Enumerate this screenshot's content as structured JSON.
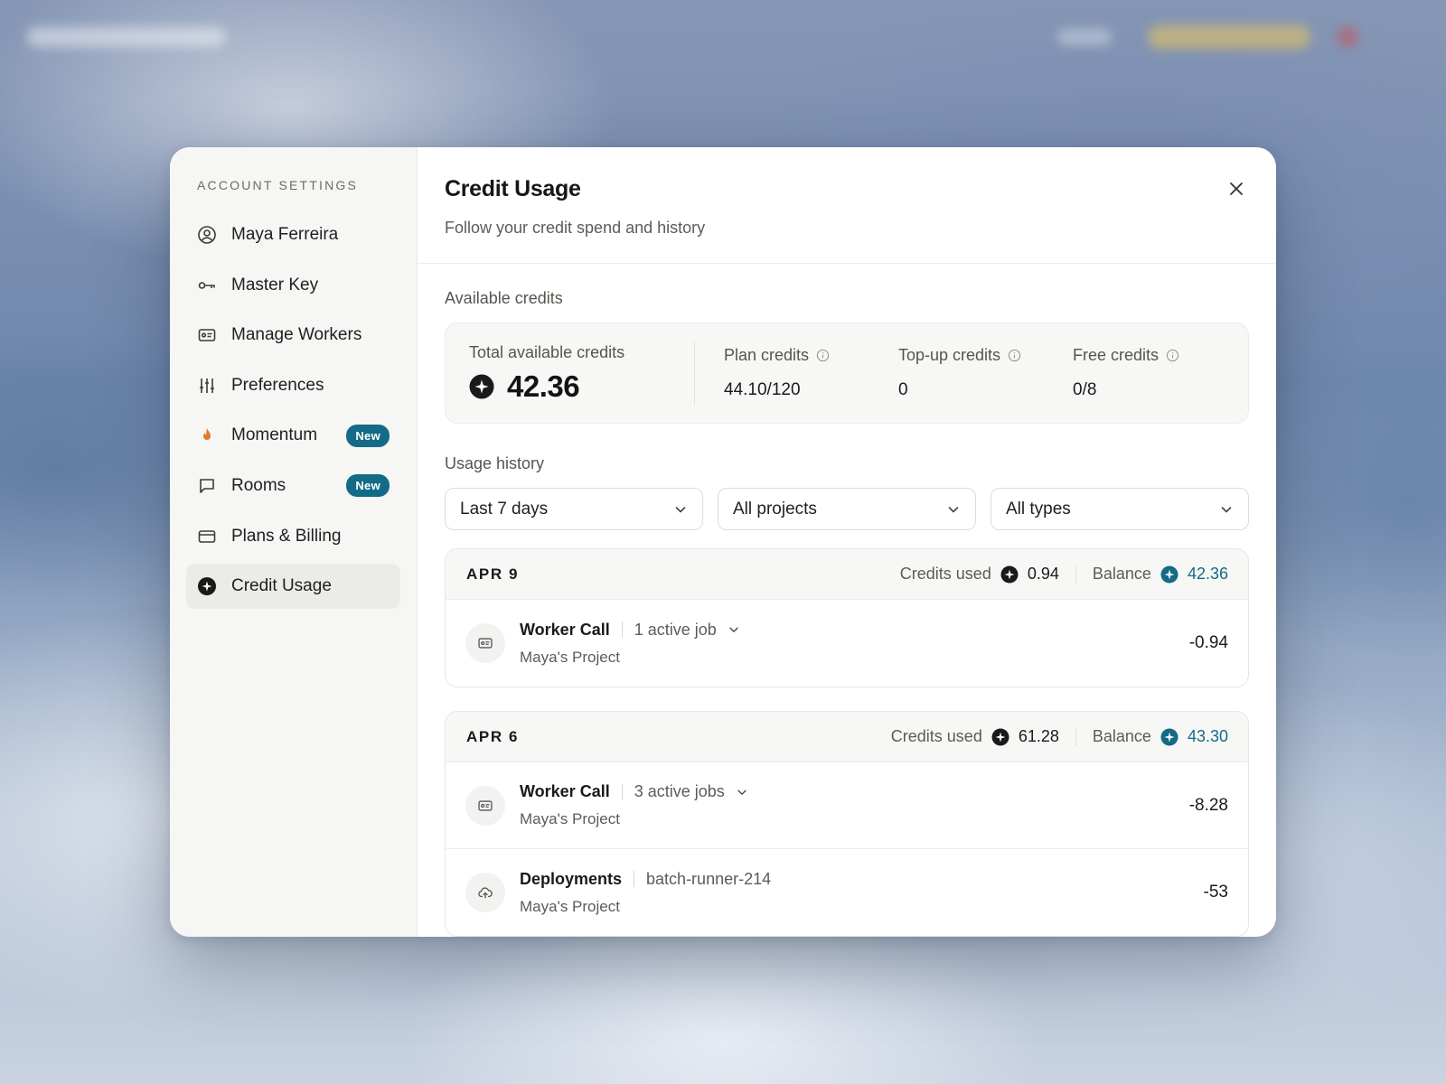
{
  "sidebar": {
    "title": "ACCOUNT SETTINGS",
    "items": [
      {
        "label": "Maya Ferreira",
        "icon": "user-circle-icon"
      },
      {
        "label": "Master Key",
        "icon": "key-icon"
      },
      {
        "label": "Manage Workers",
        "icon": "id-card-icon"
      },
      {
        "label": "Preferences",
        "icon": "sliders-icon"
      },
      {
        "label": "Momentum",
        "icon": "flame-icon",
        "badge": "New"
      },
      {
        "label": "Rooms",
        "icon": "chat-bubble-icon",
        "badge": "New"
      },
      {
        "label": "Plans & Billing",
        "icon": "credit-card-icon"
      },
      {
        "label": "Credit Usage",
        "icon": "sparkle-credit-icon",
        "active": true
      }
    ]
  },
  "header": {
    "title": "Credit Usage",
    "subtitle": "Follow your credit spend and history"
  },
  "available": {
    "section_label": "Available credits",
    "total_label": "Total available credits",
    "total_value": "42.36",
    "plan_label": "Plan credits",
    "plan_value": "44.10/120",
    "topup_label": "Top-up credits",
    "topup_value": "0",
    "free_label": "Free credits",
    "free_value": "0/8"
  },
  "history": {
    "section_label": "Usage history",
    "filters": {
      "range": "Last 7 days",
      "project": "All projects",
      "type": "All types"
    },
    "credits_used_label": "Credits used",
    "balance_label": "Balance",
    "days": [
      {
        "date": "APR 9",
        "credits_used": "0.94",
        "balance": "42.36",
        "entries": [
          {
            "name": "Worker Call",
            "meta": "1 active job",
            "project": "Maya's Project",
            "amount": "-0.94",
            "icon": "id-card-icon",
            "expandable": true
          }
        ]
      },
      {
        "date": "APR 6",
        "credits_used": "61.28",
        "balance": "43.30",
        "entries": [
          {
            "name": "Worker Call",
            "meta": "3 active jobs",
            "project": "Maya's Project",
            "amount": "-8.28",
            "icon": "id-card-icon",
            "expandable": true
          },
          {
            "name": "Deployments",
            "meta": "batch-runner-214",
            "project": "Maya's Project",
            "amount": "-53",
            "icon": "cloud-upload-icon",
            "expandable": false
          }
        ]
      }
    ]
  },
  "colors": {
    "accent": "#146b86",
    "badge_bg": "#146b86",
    "flame": "#e07a2e"
  }
}
